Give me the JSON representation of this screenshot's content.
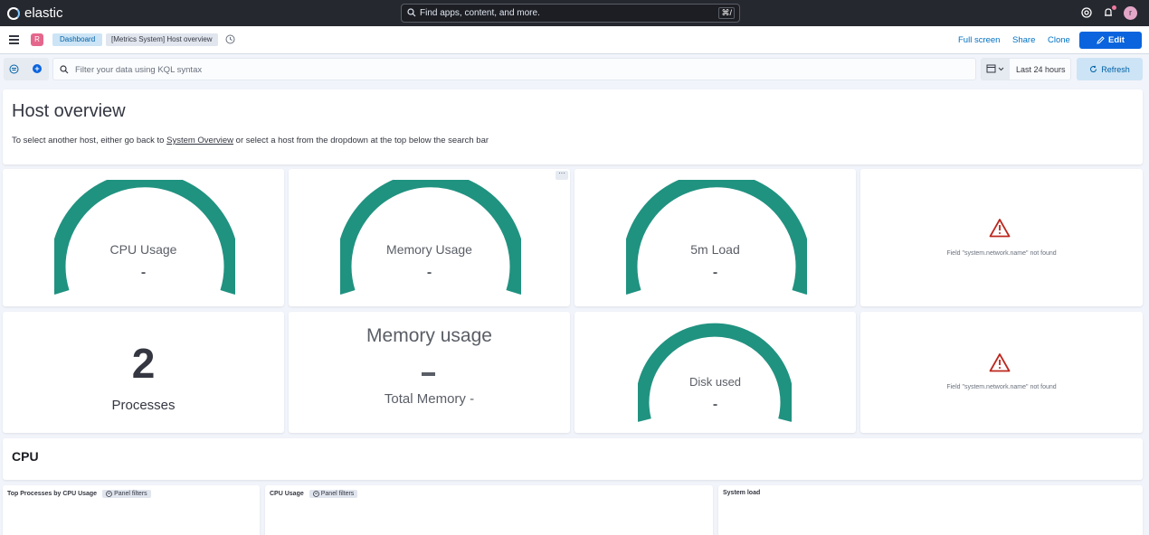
{
  "header": {
    "brand": "elastic",
    "search_placeholder": "Find apps, content, and more.",
    "search_shortcut": "⌘/",
    "user_initial": "r"
  },
  "nav": {
    "space_initial": "R",
    "breadcrumbs": [
      "Dashboard",
      "[Metrics System] Host overview"
    ],
    "links": [
      "Full screen",
      "Share",
      "Clone"
    ],
    "edit_label": "Edit"
  },
  "query": {
    "placeholder": "Filter your data using KQL syntax",
    "time_range": "Last 24 hours",
    "refresh_label": "Refresh"
  },
  "host_panel": {
    "title": "Host overview",
    "desc_before": "To select another host, either go back to ",
    "desc_link": "System Overview",
    "desc_after": " or select a host from the dropdown at the top below the search bar"
  },
  "gauges": {
    "cpu": {
      "label": "CPU Usage",
      "value": "-"
    },
    "memory": {
      "label": "Memory Usage",
      "value": "-"
    },
    "load": {
      "label": "5m Load",
      "value": "-"
    },
    "disk": {
      "label": "Disk used",
      "value": "-"
    }
  },
  "errors": {
    "network1": "Field \"system.network.name\" not found",
    "network2": "Field \"system.network.name\" not found"
  },
  "processes": {
    "value": "2",
    "label": "Processes"
  },
  "memory_usage": {
    "title": "Memory usage",
    "total": "Total Memory -"
  },
  "cpu_section": {
    "title": "CPU"
  },
  "sub_panels": {
    "top_processes": "Top Processes by CPU Usage",
    "cpu_usage": "CPU Usage",
    "system_load": "System load",
    "panel_filters": "Panel filters"
  },
  "colors": {
    "gauge": "#209280",
    "accent": "#0b64dd",
    "header_bg": "#25282f",
    "error": "#bd271e"
  }
}
